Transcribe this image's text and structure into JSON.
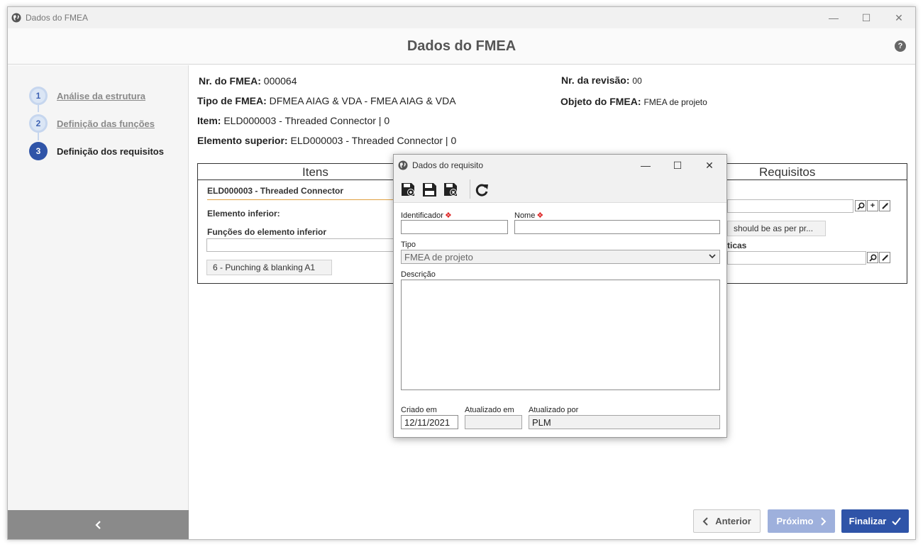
{
  "window": {
    "title": "Dados do FMEA"
  },
  "header": {
    "title": "Dados do FMEA",
    "help_icon": "?"
  },
  "steps": [
    {
      "num": "1",
      "label": "Análise da estrutura",
      "state": "done"
    },
    {
      "num": "2",
      "label": "Definição das funções",
      "state": "done"
    },
    {
      "num": "3",
      "label": "Definição dos requisitos",
      "state": "current"
    }
  ],
  "sidebar": {
    "back_icon": "chevron-left-icon"
  },
  "info": {
    "nr_fmea_label": "Nr. do FMEA:",
    "nr_fmea_value": "000064",
    "tipo_label": "Tipo de FMEA:",
    "tipo_value": "DFMEA AIAG & VDA - FMEA AIAG & VDA",
    "item_label": "Item:",
    "item_value": "ELD000003 - Threaded Connector | 0",
    "elemento_label": "Elemento superior:",
    "elemento_value": "ELD000003 - Threaded Connector | 0",
    "revisao_label": "Nr. da revisão:",
    "revisao_value": "00",
    "objeto_label": "Objeto do FMEA:",
    "objeto_value": "FMEA de projeto"
  },
  "grid": {
    "itens_title": "Itens",
    "requisitos_title": "Requisitos",
    "item_name": "ELD000003 - Threaded Connector",
    "elemento_inferior_label": "Elemento inferior:",
    "funcoes_label": "Funções do elemento inferior",
    "funcao_chip": "6 - Punching & blanking A1",
    "req_chip": "should be as per pr...",
    "caracteristicas_label": "ticas"
  },
  "footer": {
    "anterior": "Anterior",
    "proximo": "Próximo",
    "finalizar": "Finalizar"
  },
  "dialog": {
    "title": "Dados do requisito",
    "identificador_label": "Identificador",
    "identificador_value": "",
    "nome_label": "Nome",
    "nome_value": "",
    "tipo_label": "Tipo",
    "tipo_value": "FMEA de projeto",
    "descricao_label": "Descrição",
    "criado_label": "Criado em",
    "criado_value": "12/11/2021",
    "atualizado_em_label": "Atualizado em",
    "atualizado_em_value": "",
    "atualizado_por_label": "Atualizado por",
    "atualizado_por_value": "PLM"
  },
  "colors": {
    "accent": "#2f54a8",
    "accent_light": "#9eb0dc",
    "required": "#dd2222"
  }
}
